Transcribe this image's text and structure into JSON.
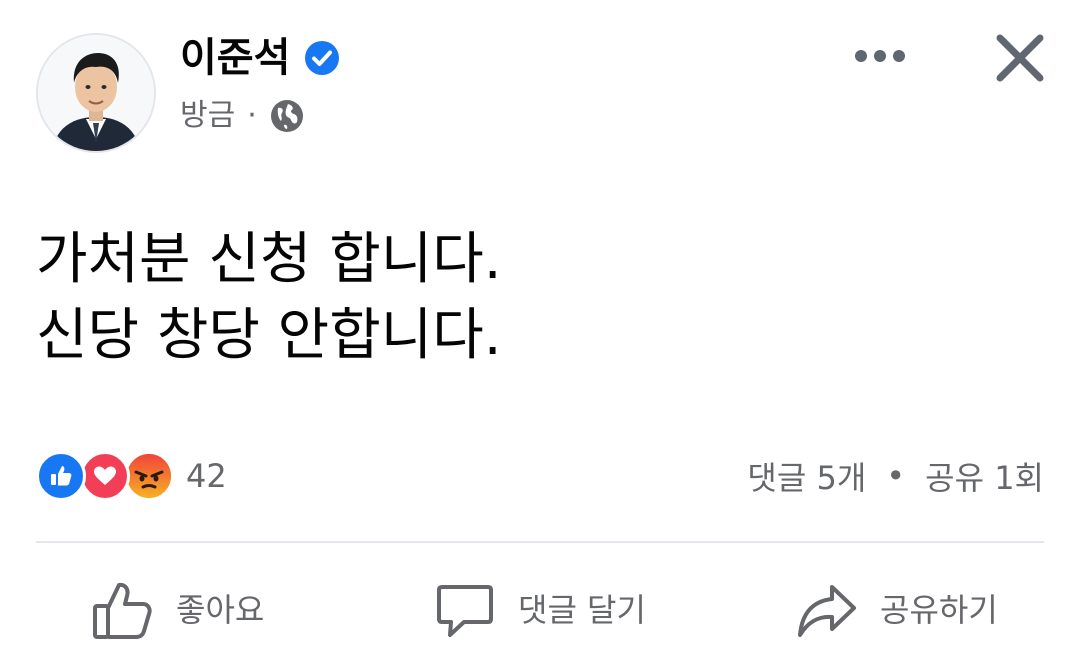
{
  "post": {
    "author": {
      "name": "이준석",
      "verified": true
    },
    "meta": {
      "time": "방금",
      "separator": "·",
      "audience_icon": "globe-icon"
    },
    "text_lines": [
      "가처분 신청 합니다.",
      "신당 창당 안합니다."
    ],
    "reactions": {
      "types": [
        "like",
        "love",
        "angry"
      ],
      "count": "42"
    },
    "stats": {
      "comments": "댓글 5개",
      "separator": "•",
      "shares": "공유 1회"
    },
    "actions": {
      "like": "좋아요",
      "comment": "댓글 달기",
      "share": "공유하기"
    }
  },
  "colors": {
    "text": "#050505",
    "secondary": "#65676b",
    "verified": "#1877f2",
    "like": "#1877f2",
    "love": "#f33e58",
    "angry": "#e9710f",
    "divider": "#e4e6eb"
  }
}
